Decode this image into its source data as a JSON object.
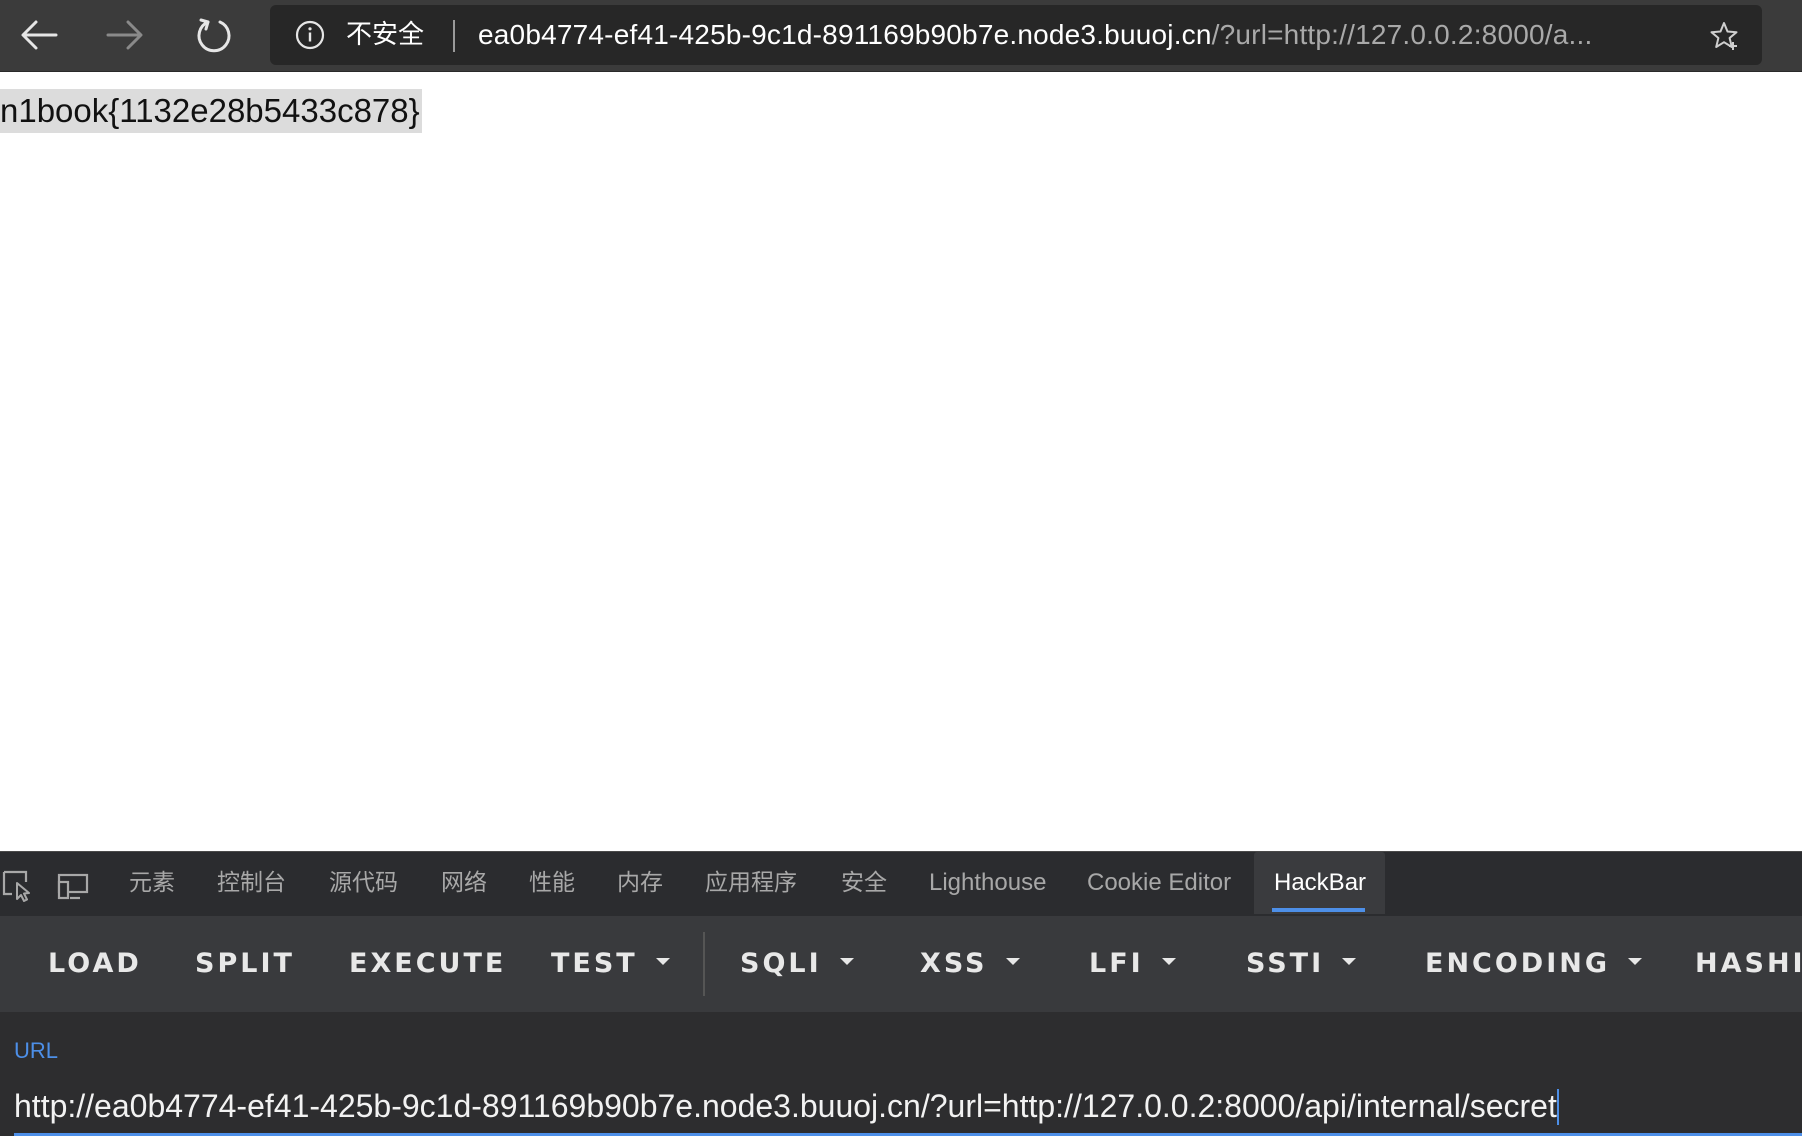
{
  "browser": {
    "security_label": "不安全",
    "url_host": "ea0b4774-ef41-425b-9c1d-891169b90b7e.node3.buuoj.cn",
    "url_rest": "/?url=http://127.0.0.2:8000/a...",
    "icons": {
      "back": "back-arrow-icon",
      "forward": "forward-arrow-icon",
      "reload": "reload-icon",
      "info": "info-icon",
      "favorite": "star-icon"
    }
  },
  "page": {
    "flag_text": "n1book{1132e28b5433c878}"
  },
  "devtools": {
    "tabs": [
      {
        "label": "元素"
      },
      {
        "label": "控制台"
      },
      {
        "label": "源代码"
      },
      {
        "label": "网络"
      },
      {
        "label": "性能"
      },
      {
        "label": "内存"
      },
      {
        "label": "应用程序"
      },
      {
        "label": "安全"
      },
      {
        "label": "Lighthouse"
      },
      {
        "label": "Cookie Editor"
      },
      {
        "label": "HackBar"
      }
    ],
    "active_tab": "HackBar",
    "accent_color": "#4d8fe8"
  },
  "hackbar": {
    "buttons": [
      {
        "label": "LOAD"
      },
      {
        "label": "SPLIT"
      },
      {
        "label": "EXECUTE"
      },
      {
        "label": "TEST"
      },
      {
        "label": "SQLI"
      },
      {
        "label": "XSS"
      },
      {
        "label": "LFI"
      },
      {
        "label": "SSTI"
      },
      {
        "label": "ENCODING"
      },
      {
        "label": "HASHIN"
      }
    ],
    "url_label": "URL",
    "url_value": "http://ea0b4774-ef41-425b-9c1d-891169b90b7e.node3.buuoj.cn/?url=http://127.0.0.2:8000/api/internal/secret"
  }
}
